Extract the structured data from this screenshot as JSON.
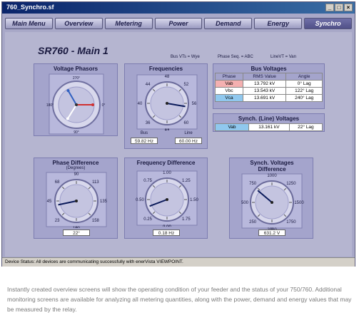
{
  "window": {
    "title": "760_Synchro.sf",
    "min": "_",
    "max": "□",
    "close": "×"
  },
  "nav": [
    "Main Menu",
    "Overview",
    "Metering",
    "Power",
    "Demand",
    "Energy",
    "Synchro"
  ],
  "page_title": "SR760 - Main 1",
  "info": {
    "bus_vts": "Bus VTs =  Wye",
    "phase_seq": "Phase Seq. =  ABC",
    "line_vt": "LineVT =  Van"
  },
  "phasors": {
    "title": "Voltage Phasors",
    "labels": [
      "270°",
      "180°",
      "0°",
      "90°"
    ],
    "vectors": [
      {
        "name": "Vab",
        "angle": 0,
        "color": "#d03030"
      },
      {
        "name": "Vbc",
        "angle": 122,
        "color": "#ffffff"
      },
      {
        "name": "Vca",
        "angle": 240,
        "color": "#3060c0"
      }
    ]
  },
  "frequencies": {
    "title": "Frequencies",
    "ticks": [
      "48",
      "44",
      "52",
      "40",
      "56",
      "36",
      "60",
      "32",
      "64"
    ],
    "bus_label": "Bus",
    "line_label": "Line",
    "bus_value": "59.82 Hz",
    "line_value": "60.00 Hz",
    "needle_value": 59.82,
    "min": 32,
    "max": 64
  },
  "bus_voltages": {
    "title": "Bus Voltages",
    "headers": [
      "Phase",
      "RMS Value",
      "Angle"
    ],
    "rows": [
      {
        "phase": "Vab",
        "rms": "13.792 kV",
        "angle": "0° Lag",
        "color": "#f4b0b0"
      },
      {
        "phase": "Vbc",
        "rms": "13.543 kV",
        "angle": "122° Lag",
        "color": "#ffffff"
      },
      {
        "phase": "Vca",
        "rms": "13.691 kV",
        "angle": "240° Lag",
        "color": "#90c8ee"
      }
    ]
  },
  "synch_line": {
    "title": "Synch. (Line) Voltages",
    "row": {
      "phase": "Vab",
      "rms": "13.161 kV",
      "angle": "22° Lag",
      "color": "#90c8ee"
    }
  },
  "phase_diff": {
    "title": "Phase Difference",
    "subtitle": "(Degrees)",
    "ticks": [
      "90",
      "68",
      "113",
      "45",
      "135",
      "23",
      "158",
      "0",
      "180"
    ],
    "value": "22°",
    "needle_value": 22,
    "min": 0,
    "max": 180
  },
  "freq_diff": {
    "title": "Frequency Difference",
    "ticks": [
      "1.00",
      "0.75",
      "1.25",
      "0.50",
      "1.50",
      "0.25",
      "1.75",
      "0.00",
      "2.00"
    ],
    "value": "0.18 Hz",
    "needle_value": 0.18,
    "min": 0,
    "max": 2
  },
  "synch_diff": {
    "title": "Synch. Voltages Difference",
    "ticks": [
      "1000",
      "750",
      "1250",
      "500",
      "1500",
      "250",
      "1750",
      "0",
      "2000"
    ],
    "value": "631.2 V",
    "needle_value": 631.2,
    "min": 0,
    "max": 2000
  },
  "status": "Device Status:  All devices are communicating successfully with enerVista VIEWPOINT.",
  "caption": "Instantly created overview screens will show the operating condition of your feeder and the status of your 750/760. Additional monitoring screens are available for analyzing all metering quantities, along with the power, demand and energy values that may be measured by the relay."
}
